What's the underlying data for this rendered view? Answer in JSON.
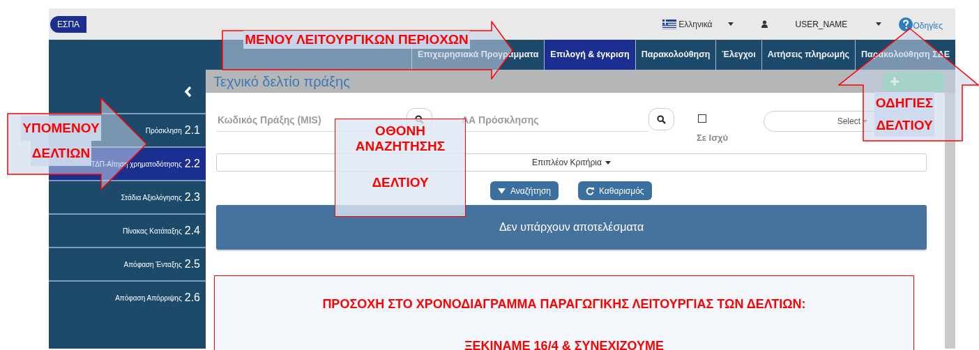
{
  "top_bar": {
    "badge": "ΕΣΠΑ",
    "language": "Ελληνικά",
    "user": "USER_NAME",
    "help": "Οδηγίες"
  },
  "menu": [
    {
      "label": "Επιχειρησιακά Προγράμματα",
      "selected": false
    },
    {
      "label": "Επιλογή & έγκριση",
      "selected": true
    },
    {
      "label": "Παρακολούθηση",
      "selected": false
    },
    {
      "label": "Έλεγχοι",
      "selected": false
    },
    {
      "label": "Αιτήσεις πληρωμής",
      "selected": false
    },
    {
      "label": "Παρακολούθηση ΣΔΕ",
      "selected": false
    }
  ],
  "sidebar": {
    "items": [
      {
        "label": "Πρόσκληση",
        "number": "2.1",
        "selected": false
      },
      {
        "label": "ΤΔΠ-Αίτηση χρηματοδότησης",
        "number": "2.2",
        "selected": true
      },
      {
        "label": "Στάδια Αξιολόγησης",
        "number": "2.3",
        "selected": false
      },
      {
        "label": "Πίνακας Κατάταξης",
        "number": "2.4",
        "selected": false
      },
      {
        "label": "Απόφαση Ένταξης",
        "number": "2.5",
        "selected": false
      },
      {
        "label": "Απόφαση Απόρριψης",
        "number": "2.6",
        "selected": false
      }
    ]
  },
  "page_title": "Τεχνικό δελτίο πράξης",
  "search": {
    "fields": [
      {
        "placeholder": "Κωδικός Πράξης (MIS)"
      },
      {
        "placeholder": "ΑΑ Πρόσκλησης"
      }
    ],
    "in_force": {
      "label": "Σε Ισχύ",
      "checked": false
    },
    "select": {
      "value": "Select"
    },
    "more_criteria": "Επιπλέον Κριτήρια",
    "buttons": [
      {
        "label": "Αναζήτηση",
        "kind": "search"
      },
      {
        "label": "Καθαρισμός",
        "kind": "clear"
      }
    ]
  },
  "results": {
    "message": "Δεν υπάρχουν αποτελέσματα"
  },
  "annotations": [
    {
      "kind": "arrow-right",
      "lines": [
        "ΜΕΝΟΥ ΛΕΙΤΟΥΡΓΙΚΩΝ ΠΕΡΙΟΧΩΝ"
      ]
    },
    {
      "kind": "arrow-right",
      "lines": [
        "ΥΠΟΜΕΝΟΥ",
        "ΔΕΛΤΙΩΝ"
      ]
    },
    {
      "kind": "box",
      "lines": [
        "ΟΘΟΝΗ",
        "ΑΝΑΖΗΤΗΣΗΣ",
        "ΔΕΛΤΙΟΥ"
      ]
    },
    {
      "kind": "arrow-up",
      "lines": [
        "ΟΔΗΓΙΕΣ",
        "ΔΕΛΤΙΟΥ"
      ]
    },
    {
      "kind": "box",
      "lines": [
        "ΠΡΟΣΟΧΗ ΣΤΟ ΧΡΟΝΟΔΙΑΓΡΑΜΜΑ ΠΑΡΑΓΩΓΙΚΗΣ ΛΕΙΤΟΥΡΓΙΑΣ ΤΩΝ ΔΕΛΤΙΩΝ:",
        "ΞΕΚΙΝΑΜΕ 16/4 & ΣΥΝΕΧΙΖΟΥΜΕ"
      ]
    }
  ]
}
